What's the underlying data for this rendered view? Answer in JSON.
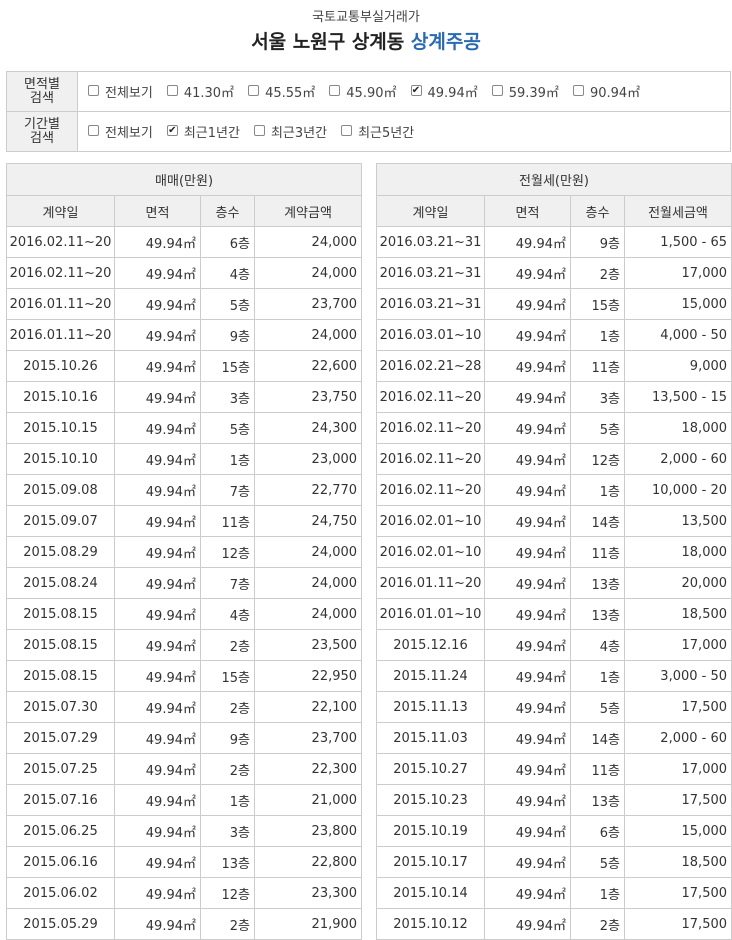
{
  "header": {
    "subtitle": "국토교통부실거래가",
    "title_plain": "서울 노원구 상계동 ",
    "title_highlight": "상계주공"
  },
  "colors": {
    "accent": "#2a6ab0",
    "border": "#cccccc",
    "header_bg": "#f0f0f0"
  },
  "area_filter": {
    "label_line1": "면적별",
    "label_line2": "검색",
    "options": [
      {
        "label": "전체보기",
        "checked": false
      },
      {
        "label": "41.30㎡",
        "checked": false
      },
      {
        "label": "45.55㎡",
        "checked": false
      },
      {
        "label": "45.90㎡",
        "checked": false
      },
      {
        "label": "49.94㎡",
        "checked": true
      },
      {
        "label": "59.39㎡",
        "checked": false
      },
      {
        "label": "90.94㎡",
        "checked": false
      }
    ]
  },
  "period_filter": {
    "label_line1": "기간별",
    "label_line2": "검색",
    "options": [
      {
        "label": "전체보기",
        "checked": false
      },
      {
        "label": "최근1년간",
        "checked": true
      },
      {
        "label": "최근3년간",
        "checked": false
      },
      {
        "label": "최근5년간",
        "checked": false
      }
    ]
  },
  "sale": {
    "caption": "매매(만원)",
    "columns": [
      "계약일",
      "면적",
      "층수",
      "계약금액"
    ],
    "rows": [
      [
        "2016.02.11~20",
        "49.94㎡",
        "6층",
        "24,000"
      ],
      [
        "2016.02.11~20",
        "49.94㎡",
        "4층",
        "24,000"
      ],
      [
        "2016.01.11~20",
        "49.94㎡",
        "5층",
        "23,700"
      ],
      [
        "2016.01.11~20",
        "49.94㎡",
        "9층",
        "24,000"
      ],
      [
        "2015.10.26",
        "49.94㎡",
        "15층",
        "22,600"
      ],
      [
        "2015.10.16",
        "49.94㎡",
        "3층",
        "23,750"
      ],
      [
        "2015.10.15",
        "49.94㎡",
        "5층",
        "24,300"
      ],
      [
        "2015.10.10",
        "49.94㎡",
        "1층",
        "23,000"
      ],
      [
        "2015.09.08",
        "49.94㎡",
        "7층",
        "22,770"
      ],
      [
        "2015.09.07",
        "49.94㎡",
        "11층",
        "24,750"
      ],
      [
        "2015.08.29",
        "49.94㎡",
        "12층",
        "24,000"
      ],
      [
        "2015.08.24",
        "49.94㎡",
        "7층",
        "24,000"
      ],
      [
        "2015.08.15",
        "49.94㎡",
        "4층",
        "24,000"
      ],
      [
        "2015.08.15",
        "49.94㎡",
        "2층",
        "23,500"
      ],
      [
        "2015.08.15",
        "49.94㎡",
        "15층",
        "22,950"
      ],
      [
        "2015.07.30",
        "49.94㎡",
        "2층",
        "22,100"
      ],
      [
        "2015.07.29",
        "49.94㎡",
        "9층",
        "23,700"
      ],
      [
        "2015.07.25",
        "49.94㎡",
        "2층",
        "22,300"
      ],
      [
        "2015.07.16",
        "49.94㎡",
        "1층",
        "21,000"
      ],
      [
        "2015.06.25",
        "49.94㎡",
        "3층",
        "23,800"
      ],
      [
        "2015.06.16",
        "49.94㎡",
        "13층",
        "22,800"
      ],
      [
        "2015.06.02",
        "49.94㎡",
        "12층",
        "23,300"
      ],
      [
        "2015.05.29",
        "49.94㎡",
        "2층",
        "21,900"
      ]
    ]
  },
  "rent": {
    "caption": "전월세(만원)",
    "columns": [
      "계약일",
      "면적",
      "층수",
      "전월세금액"
    ],
    "rows": [
      [
        "2016.03.21~31",
        "49.94㎡",
        "9층",
        "1,500 - 65"
      ],
      [
        "2016.03.21~31",
        "49.94㎡",
        "2층",
        "17,000"
      ],
      [
        "2016.03.21~31",
        "49.94㎡",
        "15층",
        "15,000"
      ],
      [
        "2016.03.01~10",
        "49.94㎡",
        "1층",
        "4,000 - 50"
      ],
      [
        "2016.02.21~28",
        "49.94㎡",
        "11층",
        "9,000"
      ],
      [
        "2016.02.11~20",
        "49.94㎡",
        "3층",
        "13,500 - 15"
      ],
      [
        "2016.02.11~20",
        "49.94㎡",
        "5층",
        "18,000"
      ],
      [
        "2016.02.11~20",
        "49.94㎡",
        "12층",
        "2,000 - 60"
      ],
      [
        "2016.02.11~20",
        "49.94㎡",
        "1층",
        "10,000 - 20"
      ],
      [
        "2016.02.01~10",
        "49.94㎡",
        "14층",
        "13,500"
      ],
      [
        "2016.02.01~10",
        "49.94㎡",
        "11층",
        "18,000"
      ],
      [
        "2016.01.11~20",
        "49.94㎡",
        "13층",
        "20,000"
      ],
      [
        "2016.01.01~10",
        "49.94㎡",
        "13층",
        "18,500"
      ],
      [
        "2015.12.16",
        "49.94㎡",
        "4층",
        "17,000"
      ],
      [
        "2015.11.24",
        "49.94㎡",
        "1층",
        "3,000 - 50"
      ],
      [
        "2015.11.13",
        "49.94㎡",
        "5층",
        "17,500"
      ],
      [
        "2015.11.03",
        "49.94㎡",
        "14층",
        "2,000 - 60"
      ],
      [
        "2015.10.27",
        "49.94㎡",
        "11층",
        "17,000"
      ],
      [
        "2015.10.23",
        "49.94㎡",
        "13층",
        "17,500"
      ],
      [
        "2015.10.19",
        "49.94㎡",
        "6층",
        "15,000"
      ],
      [
        "2015.10.17",
        "49.94㎡",
        "5층",
        "18,500"
      ],
      [
        "2015.10.14",
        "49.94㎡",
        "1층",
        "17,500"
      ],
      [
        "2015.10.12",
        "49.94㎡",
        "2층",
        "17,500"
      ]
    ]
  }
}
